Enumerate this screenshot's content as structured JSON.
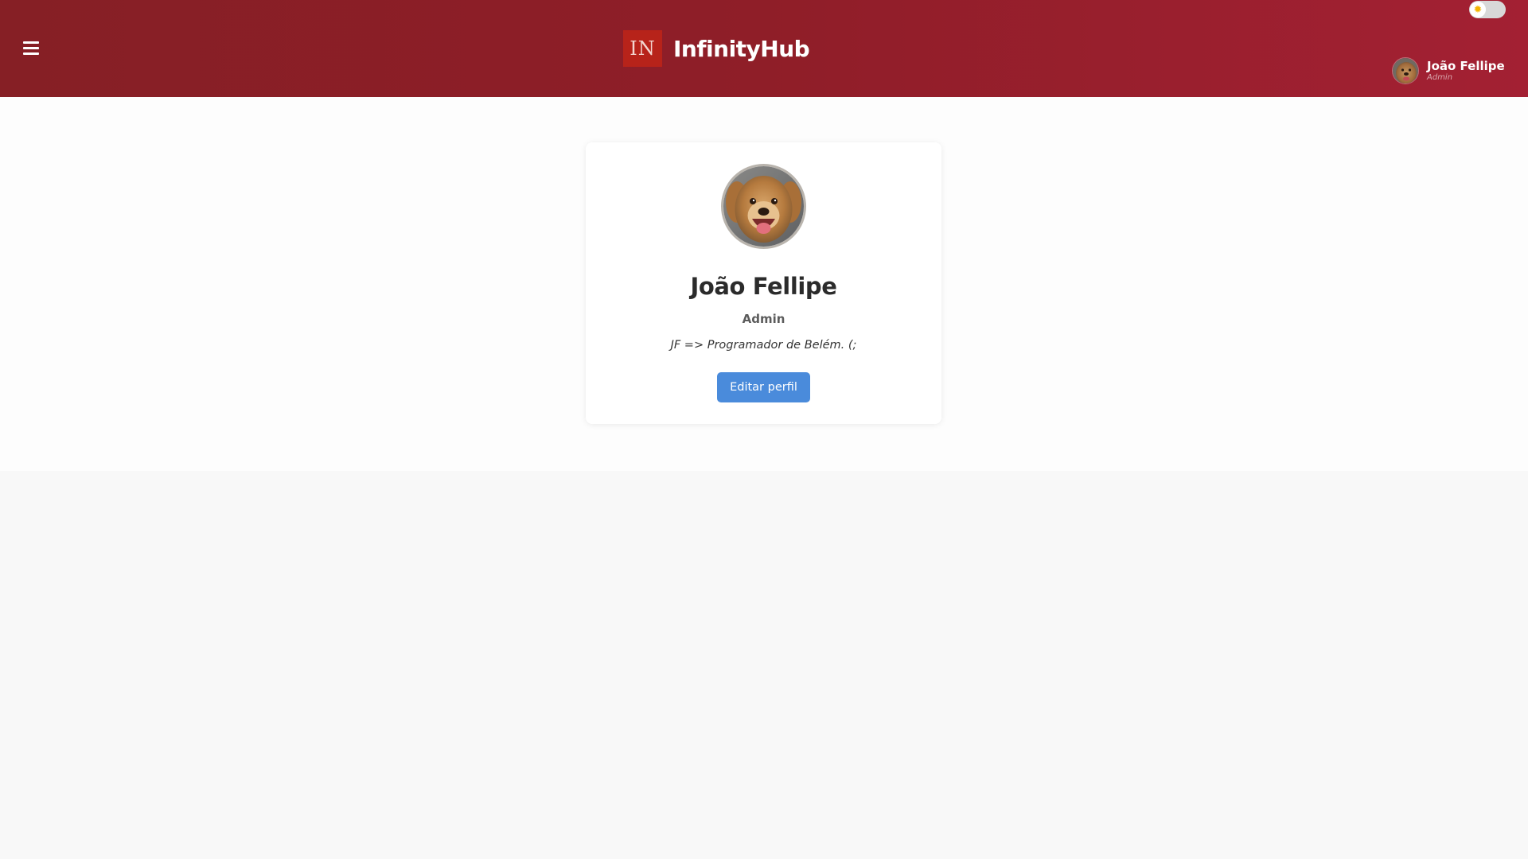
{
  "header": {
    "menu_icon": "hamburger-menu-icon",
    "brand": {
      "logo_text": "IN",
      "name": "InfinityHub",
      "logo_color": "#b7231a"
    },
    "theme_toggle": {
      "icon": "sun-icon",
      "state": "light"
    },
    "user": {
      "name": "João Fellipe",
      "role": "Admin"
    },
    "gradient_colors": [
      "#861f25",
      "#a32033"
    ]
  },
  "profile": {
    "name": "João Fellipe",
    "role": "Admin",
    "bio": "JF => Programador de Belém. (;",
    "edit_button_label": "Editar perfil",
    "button_color": "#4a8bdb"
  }
}
